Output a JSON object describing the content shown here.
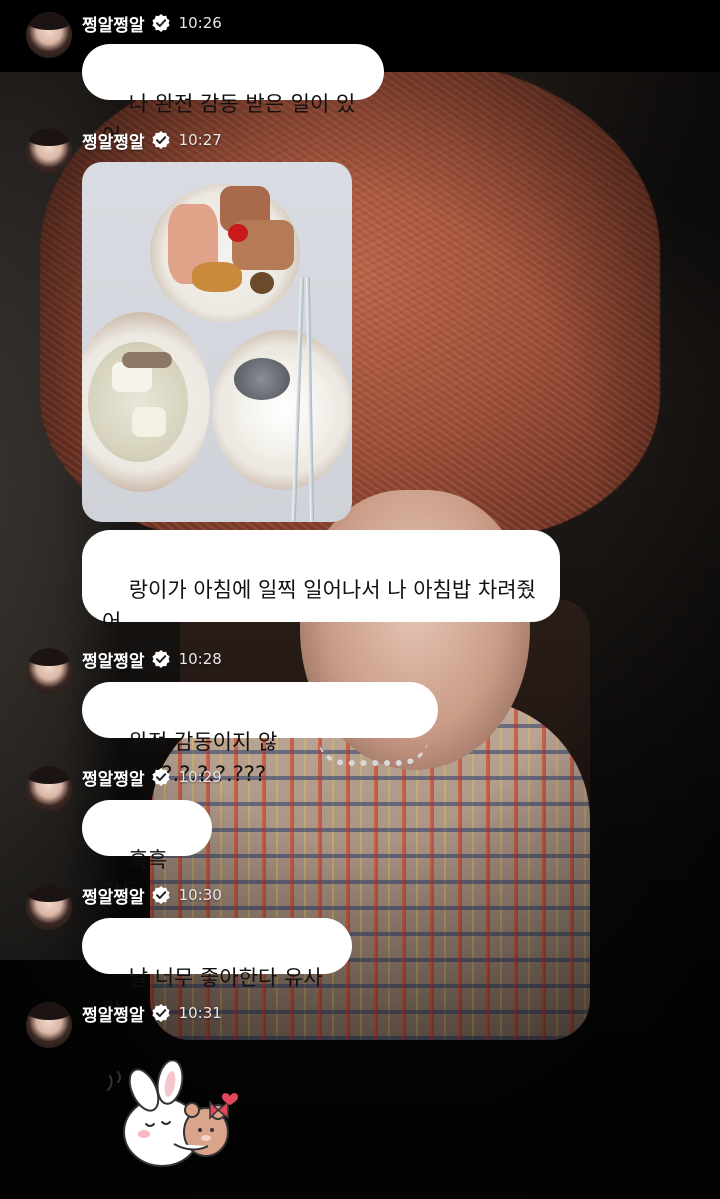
{
  "sender": {
    "name": "쩡알쩡알",
    "verified": true,
    "avatar_icon": "profile-avatar"
  },
  "messages": [
    {
      "time": "10:26",
      "texts": [
        "나 완전 감동 받은 일이 있어"
      ]
    },
    {
      "time": "10:27",
      "photo": "breakfast-photo",
      "texts": [
        "랑이가 아침에 일찍 일어나서 나 아침밥 차려줬\n어"
      ]
    },
    {
      "time": "10:28",
      "texts": [
        "완전 감동이지 않아......?.?.?.?.???"
      ]
    },
    {
      "time": "10:29",
      "texts": [
        "흑흑 감동"
      ]
    },
    {
      "time": "10:30",
      "texts": [
        "날 너무 좋아한다 유사랑"
      ]
    },
    {
      "time": "10:31",
      "sticker": "bunny-hug-sticker"
    }
  ],
  "colors": {
    "bubble_bg": "#ffffff",
    "bubble_text": "#111111",
    "meta_text": "#ffffff",
    "verified_badge": "#ffffff"
  }
}
